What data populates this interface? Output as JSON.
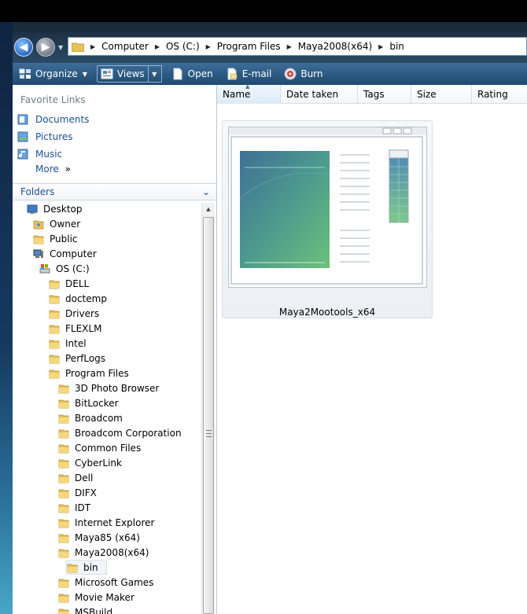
{
  "address": {
    "crumbs": [
      "Computer",
      "OS (C:)",
      "Program Files",
      "Maya2008(x64)",
      "bin"
    ]
  },
  "toolbar": {
    "organize": "Organize",
    "views": "Views",
    "open": "Open",
    "email": "E-mail",
    "burn": "Burn"
  },
  "favorites": {
    "title": "Favorite Links",
    "items": [
      "Documents",
      "Pictures",
      "Music"
    ],
    "more": "More"
  },
  "folders": {
    "title": "Folders",
    "tree": [
      {
        "label": "Desktop",
        "icon": "desktop-icon"
      },
      {
        "label": "Owner",
        "icon": "user-folder-icon"
      },
      {
        "label": "Public",
        "icon": "folder-icon"
      },
      {
        "label": "Computer",
        "icon": "computer-icon"
      },
      {
        "label": "OS (C:)",
        "icon": "drive-icon"
      },
      {
        "label": "DELL",
        "icon": "folder-icon"
      },
      {
        "label": "doctemp",
        "icon": "folder-icon"
      },
      {
        "label": "Drivers",
        "icon": "folder-icon"
      },
      {
        "label": "FLEXLM",
        "icon": "folder-icon"
      },
      {
        "label": "Intel",
        "icon": "folder-icon"
      },
      {
        "label": "PerfLogs",
        "icon": "folder-icon"
      },
      {
        "label": "Program Files",
        "icon": "folder-icon"
      },
      {
        "label": "3D Photo Browser",
        "icon": "folder-icon"
      },
      {
        "label": "BitLocker",
        "icon": "folder-icon"
      },
      {
        "label": "Broadcom",
        "icon": "folder-icon"
      },
      {
        "label": "Broadcom Corporation",
        "icon": "folder-icon"
      },
      {
        "label": "Common Files",
        "icon": "folder-icon"
      },
      {
        "label": "CyberLink",
        "icon": "folder-icon"
      },
      {
        "label": "Dell",
        "icon": "folder-icon"
      },
      {
        "label": "DIFX",
        "icon": "folder-icon"
      },
      {
        "label": "IDT",
        "icon": "folder-icon"
      },
      {
        "label": "Internet Explorer",
        "icon": "folder-icon"
      },
      {
        "label": "Maya85 (x64)",
        "icon": "folder-icon"
      },
      {
        "label": "Maya2008(x64)",
        "icon": "folder-icon"
      },
      {
        "label": "bin",
        "icon": "folder-icon",
        "selected": true
      },
      {
        "label": "Microsoft Games",
        "icon": "folder-icon"
      },
      {
        "label": "Movie Maker",
        "icon": "folder-icon"
      },
      {
        "label": "MSBuild",
        "icon": "folder-icon"
      }
    ]
  },
  "columns": [
    "Name",
    "Date taken",
    "Tags",
    "Size",
    "Rating"
  ],
  "files": [
    {
      "name": "Maya2Mootools_x64",
      "icon": "application-window-icon"
    }
  ],
  "colors": {
    "link": "#1d4f99",
    "toolbar": "#2e5b84",
    "folder": "#e8c15a"
  }
}
